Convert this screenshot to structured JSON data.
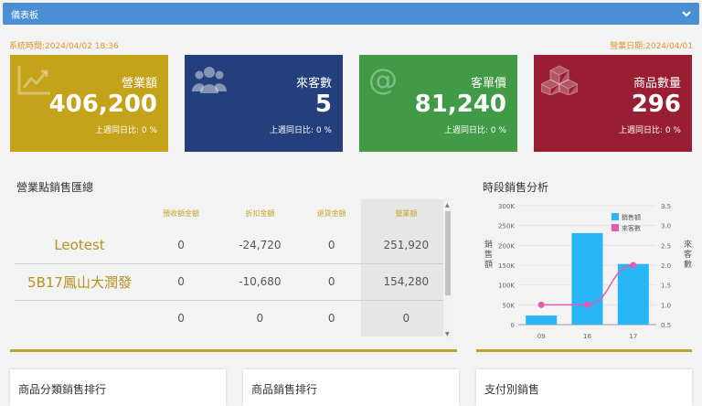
{
  "topbar": {
    "title": "儀表板"
  },
  "meta": {
    "system_time": "系統時間:2024/04/02 18:36",
    "business_date": "營業日期:2024/04/01"
  },
  "kpis": [
    {
      "label": "營業額",
      "value": "406,200",
      "compare": "上週同日比: 0 %",
      "color": "#c4a21a",
      "icon": "trend-chart-icon"
    },
    {
      "label": "來客數",
      "value": "5",
      "compare": "上週同日比: 0 %",
      "color": "#233f7c",
      "icon": "users-icon"
    },
    {
      "label": "客單價",
      "value": "81,240",
      "compare": "上週同日比: 0 %",
      "color": "#419a46",
      "icon": "at-sign-icon"
    },
    {
      "label": "商品數量",
      "value": "296",
      "compare": "上週同日比: 0 %",
      "color": "#9a1e33",
      "icon": "boxes-icon"
    }
  ],
  "sales_summary": {
    "title": "營業點銷售匯總",
    "headers": [
      "",
      "預收額金額",
      "折扣金額",
      "退貨金額",
      "營業額"
    ],
    "rows": [
      [
        "Leotest",
        "0",
        "-24,720",
        "0",
        "251,920"
      ],
      [
        "5B17鳳山大潤發",
        "0",
        "-10,680",
        "0",
        "154,280"
      ],
      [
        "",
        "0",
        "0",
        "0",
        "0"
      ]
    ]
  },
  "chart_data": {
    "type": "bar",
    "title": "時段銷售分析",
    "categories": [
      "09",
      "16",
      "17"
    ],
    "series": [
      {
        "name": "銷售額",
        "type": "bar",
        "axis": "left",
        "values": [
          23000,
          231000,
          153000
        ],
        "color": "#29b6f6"
      },
      {
        "name": "來客數",
        "type": "line",
        "axis": "right",
        "values": [
          1,
          1,
          2
        ],
        "color": "#e85ab2"
      }
    ],
    "ylabel": "銷售額",
    "y2label": "來客數",
    "ylim": [
      0,
      300000
    ],
    "y2lim": [
      0.5,
      3.5
    ],
    "yticks": [
      "0",
      "50K",
      "100K",
      "150K",
      "200K",
      "250K",
      "300K"
    ],
    "y2ticks": [
      "0.5",
      "1.0",
      "1.5",
      "2.0",
      "2.5",
      "3.0",
      "3.5"
    ],
    "grid": true,
    "legend": "top-right"
  },
  "bottom_cards": [
    "商品分類銷售排行",
    "商品銷售排行",
    "支付別銷售"
  ]
}
